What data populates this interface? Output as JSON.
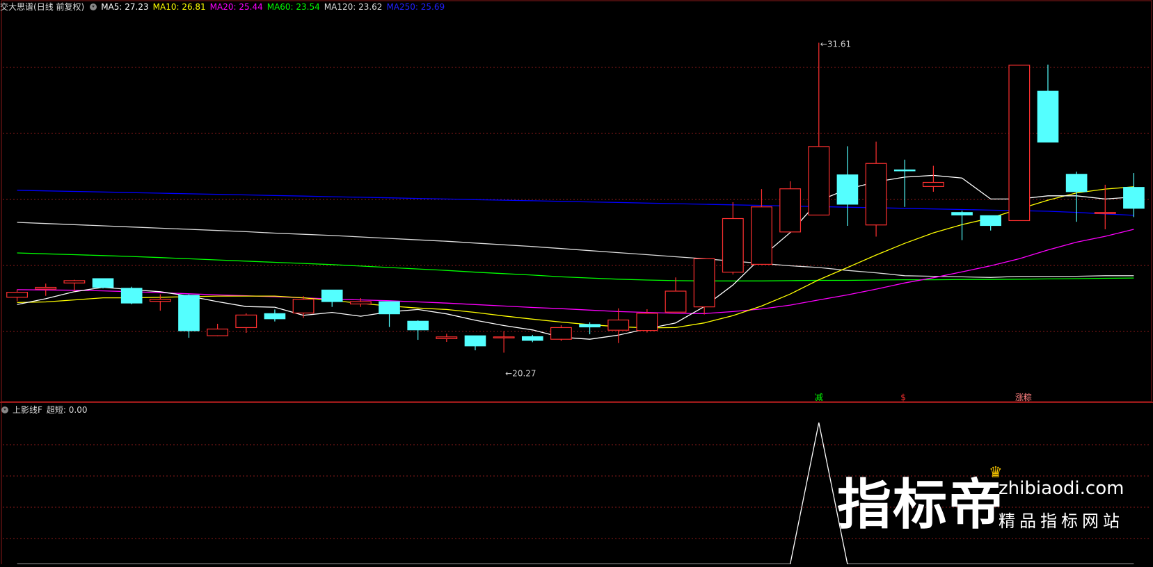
{
  "header": {
    "indicator_name": "交大思谱",
    "mode": "(日线 前复权)",
    "ma": [
      {
        "label": "MA5: 27.23",
        "color": "#ffffff"
      },
      {
        "label": "MA10: 26.81",
        "color": "#ffff00"
      },
      {
        "label": "MA20: 25.44",
        "color": "#ff00ff"
      },
      {
        "label": "MA60: 23.54",
        "color": "#00ff00"
      },
      {
        "label": "MA120: 23.62",
        "color": "#dddddd"
      },
      {
        "label": "MA250: 25.69",
        "color": "#0000ff"
      }
    ]
  },
  "sub_header": {
    "name": "上影线F",
    "value_label": "超短: 0.00"
  },
  "watermark": {
    "main": "指标帝",
    "url": "zhibiaodi.com",
    "sub": "精品指标网站"
  },
  "colors": {
    "up": "#ff3030",
    "down": "#54ffff",
    "grid": "#8b1a1a",
    "ma5": "#ffffff",
    "ma10": "#ffff00",
    "ma20": "#ff00ff",
    "ma60": "#00ff00",
    "ma120": "#dddddd",
    "ma250": "#0000ff"
  },
  "chart_data": [
    {
      "type": "candlestick",
      "title": "交大思谱",
      "ylim": [
        19.3,
        32.6
      ],
      "candles": [
        {
          "o": 22.88,
          "c": 23.05,
          "h": 23.15,
          "l": 22.74
        },
        {
          "o": 23.16,
          "c": 23.22,
          "h": 23.35,
          "l": 22.93
        },
        {
          "o": 23.37,
          "c": 23.45,
          "h": 23.48,
          "l": 23.08
        },
        {
          "o": 23.52,
          "c": 23.22,
          "h": 23.52,
          "l": 23.18
        },
        {
          "o": 23.19,
          "c": 22.68,
          "h": 23.24,
          "l": 22.64
        },
        {
          "o": 22.74,
          "c": 22.81,
          "h": 22.98,
          "l": 22.42
        },
        {
          "o": 22.95,
          "c": 21.73,
          "h": 22.98,
          "l": 21.49
        },
        {
          "o": 21.56,
          "c": 21.79,
          "h": 21.97,
          "l": 21.54
        },
        {
          "o": 21.84,
          "c": 22.27,
          "h": 22.33,
          "l": 21.66
        },
        {
          "o": 22.32,
          "c": 22.14,
          "h": 22.46,
          "l": 22.05
        },
        {
          "o": 22.34,
          "c": 22.81,
          "h": 22.92,
          "l": 22.17
        },
        {
          "o": 23.13,
          "c": 22.73,
          "h": 23.13,
          "l": 22.55
        },
        {
          "o": 22.65,
          "c": 22.73,
          "h": 22.85,
          "l": 22.55
        },
        {
          "o": 22.73,
          "c": 22.31,
          "h": 22.73,
          "l": 21.86
        },
        {
          "o": 22.06,
          "c": 21.76,
          "h": 22.09,
          "l": 21.42
        },
        {
          "o": 21.46,
          "c": 21.52,
          "h": 21.63,
          "l": 21.35
        },
        {
          "o": 21.56,
          "c": 21.21,
          "h": 21.56,
          "l": 21.06
        },
        {
          "o": 21.49,
          "c": 21.52,
          "h": 21.72,
          "l": 20.98
        },
        {
          "o": 21.53,
          "c": 21.4,
          "h": 21.59,
          "l": 21.34
        },
        {
          "o": 21.44,
          "c": 21.84,
          "h": 21.92,
          "l": 21.38
        },
        {
          "o": 21.95,
          "c": 21.86,
          "h": 22.02,
          "l": 21.61
        },
        {
          "o": 21.75,
          "c": 22.1,
          "h": 22.5,
          "l": 21.31
        },
        {
          "o": 21.74,
          "c": 22.33,
          "h": 22.47,
          "l": 21.67
        },
        {
          "o": 22.37,
          "c": 23.09,
          "h": 23.56,
          "l": 22.37
        },
        {
          "o": 22.55,
          "c": 24.2,
          "h": 24.2,
          "l": 22.29
        },
        {
          "o": 23.74,
          "c": 25.58,
          "h": 26.14,
          "l": 23.66
        },
        {
          "o": 24.01,
          "c": 25.98,
          "h": 26.59,
          "l": 24.01
        },
        {
          "o": 25.12,
          "c": 26.6,
          "h": 26.86,
          "l": 25.12
        },
        {
          "o": 25.7,
          "c": 28.05,
          "h": 31.61,
          "l": 25.7
        },
        {
          "o": 27.08,
          "c": 26.07,
          "h": 28.06,
          "l": 25.33
        },
        {
          "o": 25.36,
          "c": 27.47,
          "h": 28.22,
          "l": 24.96
        },
        {
          "o": 27.25,
          "c": 27.22,
          "h": 27.6,
          "l": 25.98
        },
        {
          "o": 26.68,
          "c": 26.82,
          "h": 27.39,
          "l": 26.5
        },
        {
          "o": 25.79,
          "c": 25.7,
          "h": 25.85,
          "l": 24.84
        },
        {
          "o": 25.68,
          "c": 25.34,
          "h": 25.68,
          "l": 25.17
        },
        {
          "o": 25.51,
          "c": 30.84,
          "h": 30.84,
          "l": 25.51
        },
        {
          "o": 29.95,
          "c": 28.2,
          "h": 30.86,
          "l": 28.2
        },
        {
          "o": 27.1,
          "c": 26.5,
          "h": 27.19,
          "l": 25.47
        },
        {
          "o": 25.79,
          "c": 25.79,
          "h": 26.74,
          "l": 25.21
        },
        {
          "o": 26.65,
          "c": 25.93,
          "h": 27.14,
          "l": 25.63
        }
      ],
      "ma5": [
        22.63,
        22.83,
        23.07,
        23.22,
        23.14,
        23.07,
        22.92,
        22.73,
        22.56,
        22.54,
        22.26,
        22.36,
        22.23,
        22.38,
        22.46,
        22.31,
        22.09,
        21.91,
        21.76,
        21.51,
        21.44,
        21.58,
        21.8,
        22.0,
        22.56,
        23.3,
        24.26,
        25.1,
        26.19,
        26.59,
        26.84,
        27.0,
        27.06,
        26.97,
        26.25,
        26.25,
        26.36,
        26.36,
        26.25,
        26.32
      ],
      "ma10": [
        22.7,
        22.72,
        22.79,
        22.86,
        22.86,
        22.88,
        22.9,
        22.92,
        22.92,
        22.92,
        22.86,
        22.77,
        22.67,
        22.58,
        22.51,
        22.46,
        22.36,
        22.24,
        22.13,
        22.03,
        21.94,
        21.87,
        21.83,
        21.84,
        22.0,
        22.25,
        22.58,
        22.99,
        23.48,
        23.9,
        24.33,
        24.73,
        25.09,
        25.37,
        25.6,
        25.91,
        26.21,
        26.46,
        26.59,
        26.67
      ],
      "ma20": [
        23.14,
        23.13,
        23.12,
        23.1,
        23.07,
        23.04,
        23.0,
        22.96,
        22.93,
        22.9,
        22.86,
        22.82,
        22.79,
        22.76,
        22.72,
        22.68,
        22.63,
        22.58,
        22.53,
        22.49,
        22.44,
        22.39,
        22.36,
        22.33,
        22.32,
        22.39,
        22.48,
        22.61,
        22.79,
        22.96,
        23.16,
        23.37,
        23.55,
        23.75,
        23.96,
        24.2,
        24.5,
        24.77,
        24.97,
        25.21
      ],
      "ma60": [
        24.4,
        24.37,
        24.34,
        24.31,
        24.28,
        24.24,
        24.2,
        24.16,
        24.12,
        24.08,
        24.04,
        24.0,
        23.95,
        23.9,
        23.85,
        23.8,
        23.74,
        23.69,
        23.64,
        23.58,
        23.54,
        23.5,
        23.47,
        23.45,
        23.44,
        23.44,
        23.44,
        23.45,
        23.46,
        23.46,
        23.47,
        23.48,
        23.48,
        23.49,
        23.49,
        23.5,
        23.51,
        23.52,
        23.53,
        23.54
      ],
      "ma120": [
        25.45,
        25.41,
        25.37,
        25.33,
        25.29,
        25.25,
        25.21,
        25.17,
        25.13,
        25.08,
        25.04,
        25.0,
        24.95,
        24.9,
        24.85,
        24.8,
        24.74,
        24.68,
        24.62,
        24.55,
        24.48,
        24.41,
        24.34,
        24.27,
        24.2,
        24.12,
        24.04,
        23.96,
        23.9,
        23.8,
        23.72,
        23.62,
        23.6,
        23.58,
        23.56,
        23.6,
        23.6,
        23.6,
        23.62,
        23.62
      ],
      "ma250": [
        26.55,
        26.53,
        26.51,
        26.49,
        26.47,
        26.45,
        26.43,
        26.41,
        26.39,
        26.37,
        26.35,
        26.33,
        26.31,
        26.29,
        26.27,
        26.25,
        26.23,
        26.21,
        26.19,
        26.17,
        26.15,
        26.13,
        26.11,
        26.09,
        26.07,
        26.05,
        26.03,
        26.01,
        25.99,
        25.97,
        25.95,
        25.93,
        25.91,
        25.89,
        25.87,
        25.85,
        25.83,
        25.79,
        25.74,
        25.69
      ],
      "annotations": [
        {
          "text": "31.61",
          "index": 28,
          "value": 31.61,
          "pos": "high"
        },
        {
          "text": "20.27",
          "index": 17,
          "value": 20.98,
          "pos": "low"
        }
      ],
      "signals": [
        {
          "text": "减",
          "index": 28,
          "color": "#00ff00"
        },
        {
          "text": "$",
          "index": 31,
          "color": "#ff3030"
        },
        {
          "text": "涨粽",
          "index": 35,
          "color": "#ff8080"
        }
      ]
    },
    {
      "type": "line",
      "title": "上影线F",
      "ylim": [
        0,
        1.05
      ],
      "series": [
        {
          "name": "超短",
          "values": [
            0,
            0,
            0,
            0,
            0,
            0,
            0,
            0,
            0,
            0,
            0,
            0,
            0,
            0,
            0,
            0,
            0,
            0,
            0,
            0,
            0,
            0,
            0,
            0,
            0,
            0,
            0,
            0,
            1.0,
            0,
            0,
            0,
            0,
            0,
            0,
            0,
            0,
            0,
            0,
            0
          ]
        }
      ]
    }
  ]
}
